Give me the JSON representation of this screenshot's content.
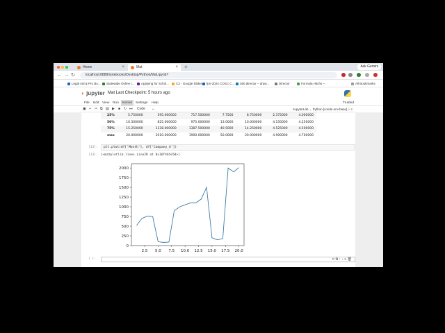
{
  "tabs": [
    {
      "label": "Home",
      "active": false
    },
    {
      "label": "Mat",
      "active": true
    }
  ],
  "ask_button": "Ask Gemini",
  "url": "localhost:8888/notebooks/Desktop/Python/Mat.ipynb?",
  "bookmarks": [
    "Legal Aid & Pro Bo...",
    "Statewide Online I...",
    "Applying for Schol...",
    "C3 - Google Slides",
    "fpn-2024 COSC C...",
    "360.director – draw...",
    "Director",
    "Formula Hitchs –",
    "All Bookmarks"
  ],
  "jupyter": {
    "logo": "jupyter",
    "title": "Mat  Last Checkpoint: 5 hours ago"
  },
  "menu": [
    "File",
    "Edit",
    "View",
    "Run",
    "Kernel",
    "Settings",
    "Help"
  ],
  "trusted": "Trusted",
  "toolbar": {
    "cell_type": "Code",
    "kernel": "JupyterLab  ⌄  Python [conda env:base] ○  ≡"
  },
  "stats_rows": [
    [
      "25%",
      "5.750000",
      "395.000000",
      "717.500000",
      "7.7500",
      "8.750000",
      "2.375000",
      "4.000000"
    ],
    [
      "50%",
      "10.500000",
      "825.000000",
      "975.000000",
      "13.0000",
      "10.000000",
      "4.150000",
      "4.250000"
    ],
    [
      "75%",
      "15.250000",
      "1138.000000",
      "1387.500000",
      "40.5000",
      "14.250000",
      "4.525000",
      "4.500000"
    ],
    [
      "max",
      "20.000000",
      "2010.000000",
      "1900.000000",
      "50.0000",
      "20.000000",
      "4.900000",
      "4.700000"
    ]
  ],
  "cell_prompt": "[13]:",
  "cell_code": "plt.plot(df['Month'], df['Company_A'])",
  "out_prompt": "[13]:",
  "out_text": "[<matplotlib.lines.Line2D at 0x16f4b5e50>]",
  "active_prompt": "[ ]:",
  "chart_data": {
    "type": "line",
    "x": [
      1,
      2,
      3,
      4,
      5,
      6,
      7,
      8,
      9,
      10,
      11,
      12,
      13,
      14,
      15,
      16,
      17,
      18,
      19,
      20
    ],
    "values": [
      520,
      700,
      760,
      750,
      100,
      80,
      90,
      900,
      1000,
      1050,
      1100,
      1100,
      1200,
      1500,
      200,
      150,
      180,
      2000,
      1900,
      2010
    ],
    "xticks": [
      "2.5",
      "5.0",
      "7.5",
      "10.0",
      "12.5",
      "15.0",
      "17.5",
      "20.0"
    ],
    "yticks": [
      "0",
      "250",
      "500",
      "750",
      "1000",
      "1250",
      "1500",
      "1750",
      "2000"
    ],
    "xlim": [
      0.05,
      20.95
    ],
    "ylim": [
      0,
      2110
    ],
    "line_color": "#3e7ca0"
  }
}
